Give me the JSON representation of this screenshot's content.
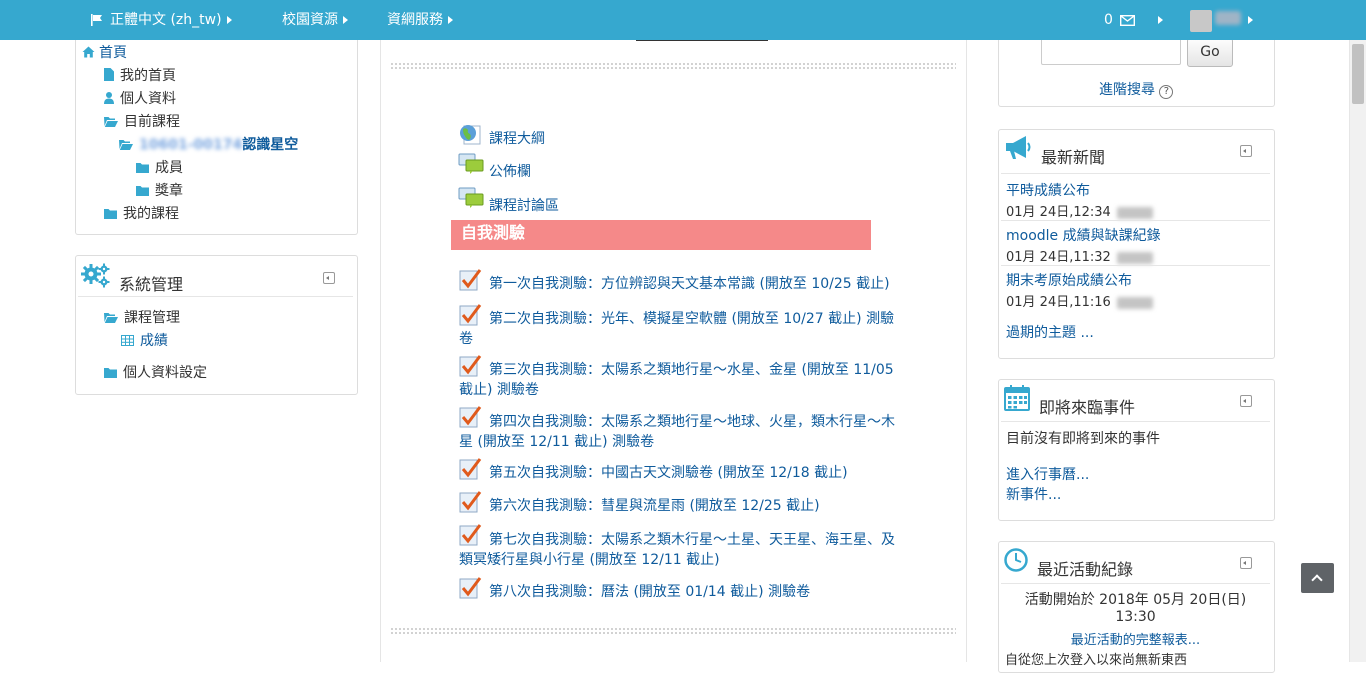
{
  "navbar": {
    "language": "正體中文 (zh_tw)",
    "campus": "校園資源",
    "network": "資網服務",
    "messages_count": "0"
  },
  "left_nav": {
    "home": "首頁",
    "my_home": "我的首頁",
    "profile": "個人資料",
    "current_course": "目前課程",
    "course_code": "10601-00174",
    "course_name": "認識星空",
    "participants": "成員",
    "badges": "獎章",
    "my_courses": "我的課程"
  },
  "admin_block": {
    "title": "系統管理",
    "course_admin": "課程管理",
    "grades": "成績",
    "profile_settings": "個人資料設定"
  },
  "center": {
    "resources": [
      "課程大綱",
      "公佈欄",
      "課程討論區"
    ],
    "section_title": "自我測驗",
    "quizzes": [
      "第一次自我測驗：方位辨認與天文基本常識 (開放至 10/25 截止)",
      "第二次自我測驗：光年、模擬星空軟體 (開放至 10/27 截止) 測驗卷",
      "第三次自我測驗：太陽系之類地行星～水星、金星 (開放至 11/05 截止) 測驗卷",
      "第四次自我測驗：太陽系之類地行星～地球、火星，類木行星～木星 (開放至 12/11 截止) 測驗卷",
      "第五次自我測驗：中國古天文測驗卷 (開放至 12/18 截止)",
      "第六次自我測驗：彗星與流星雨 (開放至 12/25 截止)",
      "第七次自我測驗：太陽系之類木行星～土星、天王星、海王星、及類冥矮行星與小行星 (開放至 12/11 截止)",
      "第八次自我測驗：曆法 (開放至 01/14 截止) 測驗卷"
    ]
  },
  "search_block": {
    "go": "Go",
    "advanced": "進階搜尋"
  },
  "news_block": {
    "title": "最新新聞",
    "items": [
      {
        "subject": "平時成績公布",
        "date": "01月 24日,12:34"
      },
      {
        "subject": "moodle 成績與缺課紀錄",
        "date": "01月 24日,11:32"
      },
      {
        "subject": "期末考原始成績公布",
        "date": "01月 24日,11:16"
      }
    ],
    "older": "過期的主題 ..."
  },
  "events_block": {
    "title": "即將來臨事件",
    "none": "目前沒有即將到來的事件",
    "goto_calendar": "進入行事曆...",
    "new_event": "新事件..."
  },
  "activity_block": {
    "title": "最近活動紀錄",
    "since": "活動開始於 2018年 05月 20日(日)",
    "time": "13:30",
    "full_report": "最近活動的完整報表...",
    "nothing_new": "自從您上次登入以來尚無新東西"
  },
  "colors": {
    "navbar": "#36a8cf",
    "section_bar": "#f58989",
    "link": "#0f5b9c"
  }
}
